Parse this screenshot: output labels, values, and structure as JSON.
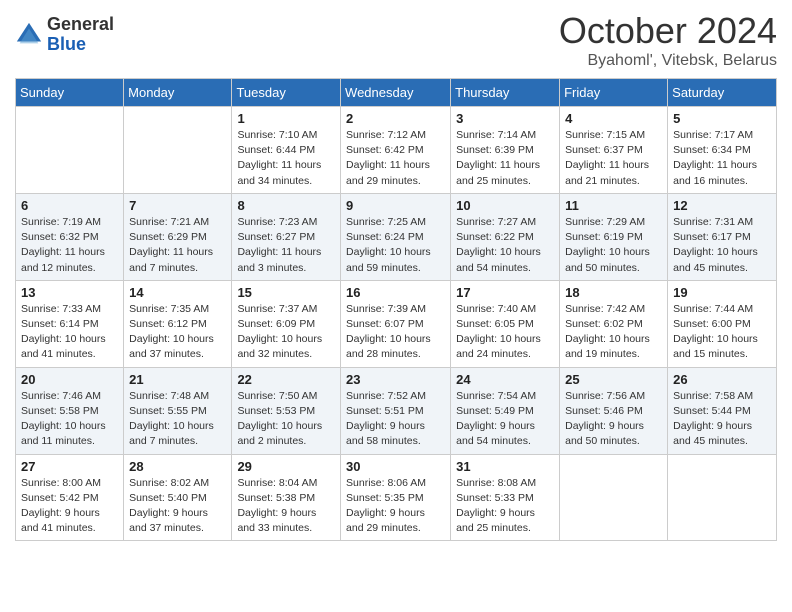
{
  "header": {
    "logo_general": "General",
    "logo_blue": "Blue",
    "month_title": "October 2024",
    "subtitle": "Byahoml', Vitebsk, Belarus"
  },
  "weekdays": [
    "Sunday",
    "Monday",
    "Tuesday",
    "Wednesday",
    "Thursday",
    "Friday",
    "Saturday"
  ],
  "weeks": [
    [
      {
        "day": "",
        "sunrise": "",
        "sunset": "",
        "daylight": ""
      },
      {
        "day": "",
        "sunrise": "",
        "sunset": "",
        "daylight": ""
      },
      {
        "day": "1",
        "sunrise": "Sunrise: 7:10 AM",
        "sunset": "Sunset: 6:44 PM",
        "daylight": "Daylight: 11 hours and 34 minutes."
      },
      {
        "day": "2",
        "sunrise": "Sunrise: 7:12 AM",
        "sunset": "Sunset: 6:42 PM",
        "daylight": "Daylight: 11 hours and 29 minutes."
      },
      {
        "day": "3",
        "sunrise": "Sunrise: 7:14 AM",
        "sunset": "Sunset: 6:39 PM",
        "daylight": "Daylight: 11 hours and 25 minutes."
      },
      {
        "day": "4",
        "sunrise": "Sunrise: 7:15 AM",
        "sunset": "Sunset: 6:37 PM",
        "daylight": "Daylight: 11 hours and 21 minutes."
      },
      {
        "day": "5",
        "sunrise": "Sunrise: 7:17 AM",
        "sunset": "Sunset: 6:34 PM",
        "daylight": "Daylight: 11 hours and 16 minutes."
      }
    ],
    [
      {
        "day": "6",
        "sunrise": "Sunrise: 7:19 AM",
        "sunset": "Sunset: 6:32 PM",
        "daylight": "Daylight: 11 hours and 12 minutes."
      },
      {
        "day": "7",
        "sunrise": "Sunrise: 7:21 AM",
        "sunset": "Sunset: 6:29 PM",
        "daylight": "Daylight: 11 hours and 7 minutes."
      },
      {
        "day": "8",
        "sunrise": "Sunrise: 7:23 AM",
        "sunset": "Sunset: 6:27 PM",
        "daylight": "Daylight: 11 hours and 3 minutes."
      },
      {
        "day": "9",
        "sunrise": "Sunrise: 7:25 AM",
        "sunset": "Sunset: 6:24 PM",
        "daylight": "Daylight: 10 hours and 59 minutes."
      },
      {
        "day": "10",
        "sunrise": "Sunrise: 7:27 AM",
        "sunset": "Sunset: 6:22 PM",
        "daylight": "Daylight: 10 hours and 54 minutes."
      },
      {
        "day": "11",
        "sunrise": "Sunrise: 7:29 AM",
        "sunset": "Sunset: 6:19 PM",
        "daylight": "Daylight: 10 hours and 50 minutes."
      },
      {
        "day": "12",
        "sunrise": "Sunrise: 7:31 AM",
        "sunset": "Sunset: 6:17 PM",
        "daylight": "Daylight: 10 hours and 45 minutes."
      }
    ],
    [
      {
        "day": "13",
        "sunrise": "Sunrise: 7:33 AM",
        "sunset": "Sunset: 6:14 PM",
        "daylight": "Daylight: 10 hours and 41 minutes."
      },
      {
        "day": "14",
        "sunrise": "Sunrise: 7:35 AM",
        "sunset": "Sunset: 6:12 PM",
        "daylight": "Daylight: 10 hours and 37 minutes."
      },
      {
        "day": "15",
        "sunrise": "Sunrise: 7:37 AM",
        "sunset": "Sunset: 6:09 PM",
        "daylight": "Daylight: 10 hours and 32 minutes."
      },
      {
        "day": "16",
        "sunrise": "Sunrise: 7:39 AM",
        "sunset": "Sunset: 6:07 PM",
        "daylight": "Daylight: 10 hours and 28 minutes."
      },
      {
        "day": "17",
        "sunrise": "Sunrise: 7:40 AM",
        "sunset": "Sunset: 6:05 PM",
        "daylight": "Daylight: 10 hours and 24 minutes."
      },
      {
        "day": "18",
        "sunrise": "Sunrise: 7:42 AM",
        "sunset": "Sunset: 6:02 PM",
        "daylight": "Daylight: 10 hours and 19 minutes."
      },
      {
        "day": "19",
        "sunrise": "Sunrise: 7:44 AM",
        "sunset": "Sunset: 6:00 PM",
        "daylight": "Daylight: 10 hours and 15 minutes."
      }
    ],
    [
      {
        "day": "20",
        "sunrise": "Sunrise: 7:46 AM",
        "sunset": "Sunset: 5:58 PM",
        "daylight": "Daylight: 10 hours and 11 minutes."
      },
      {
        "day": "21",
        "sunrise": "Sunrise: 7:48 AM",
        "sunset": "Sunset: 5:55 PM",
        "daylight": "Daylight: 10 hours and 7 minutes."
      },
      {
        "day": "22",
        "sunrise": "Sunrise: 7:50 AM",
        "sunset": "Sunset: 5:53 PM",
        "daylight": "Daylight: 10 hours and 2 minutes."
      },
      {
        "day": "23",
        "sunrise": "Sunrise: 7:52 AM",
        "sunset": "Sunset: 5:51 PM",
        "daylight": "Daylight: 9 hours and 58 minutes."
      },
      {
        "day": "24",
        "sunrise": "Sunrise: 7:54 AM",
        "sunset": "Sunset: 5:49 PM",
        "daylight": "Daylight: 9 hours and 54 minutes."
      },
      {
        "day": "25",
        "sunrise": "Sunrise: 7:56 AM",
        "sunset": "Sunset: 5:46 PM",
        "daylight": "Daylight: 9 hours and 50 minutes."
      },
      {
        "day": "26",
        "sunrise": "Sunrise: 7:58 AM",
        "sunset": "Sunset: 5:44 PM",
        "daylight": "Daylight: 9 hours and 45 minutes."
      }
    ],
    [
      {
        "day": "27",
        "sunrise": "Sunrise: 8:00 AM",
        "sunset": "Sunset: 5:42 PM",
        "daylight": "Daylight: 9 hours and 41 minutes."
      },
      {
        "day": "28",
        "sunrise": "Sunrise: 8:02 AM",
        "sunset": "Sunset: 5:40 PM",
        "daylight": "Daylight: 9 hours and 37 minutes."
      },
      {
        "day": "29",
        "sunrise": "Sunrise: 8:04 AM",
        "sunset": "Sunset: 5:38 PM",
        "daylight": "Daylight: 9 hours and 33 minutes."
      },
      {
        "day": "30",
        "sunrise": "Sunrise: 8:06 AM",
        "sunset": "Sunset: 5:35 PM",
        "daylight": "Daylight: 9 hours and 29 minutes."
      },
      {
        "day": "31",
        "sunrise": "Sunrise: 8:08 AM",
        "sunset": "Sunset: 5:33 PM",
        "daylight": "Daylight: 9 hours and 25 minutes."
      },
      {
        "day": "",
        "sunrise": "",
        "sunset": "",
        "daylight": ""
      },
      {
        "day": "",
        "sunrise": "",
        "sunset": "",
        "daylight": ""
      }
    ]
  ]
}
